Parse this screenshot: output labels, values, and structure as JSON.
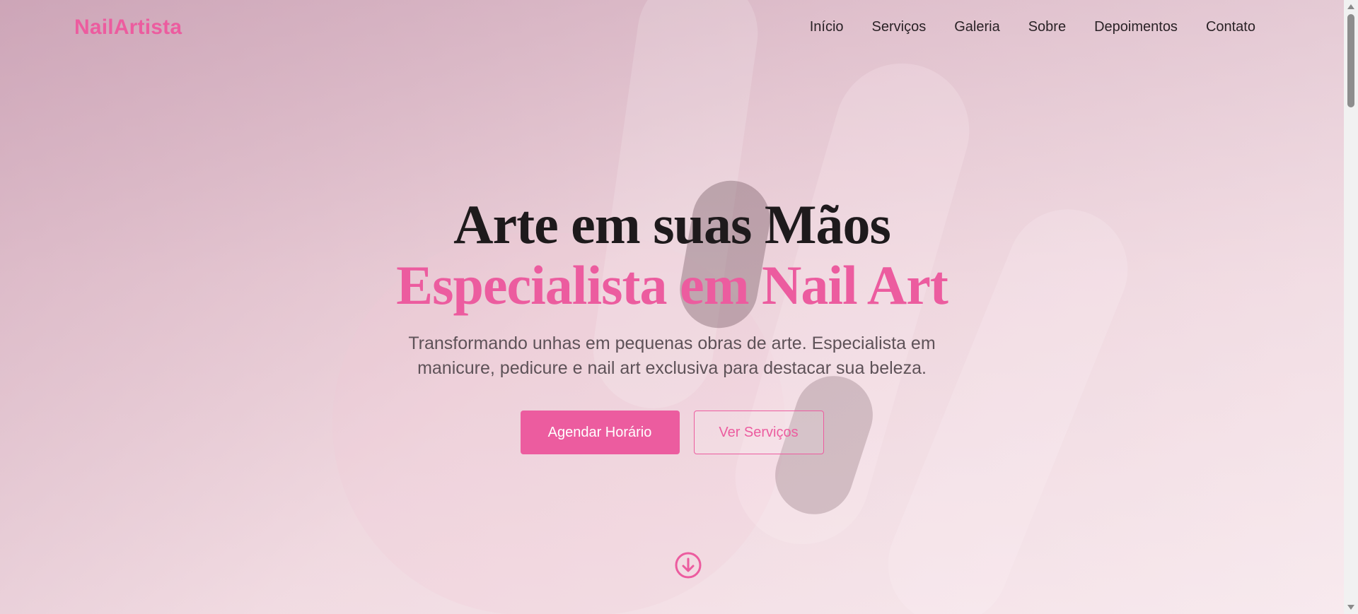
{
  "brand": {
    "name": "NailArtista",
    "accent": "#ec5c9f"
  },
  "nav": {
    "items": [
      {
        "label": "Início"
      },
      {
        "label": "Serviços"
      },
      {
        "label": "Galeria"
      },
      {
        "label": "Sobre"
      },
      {
        "label": "Depoimentos"
      },
      {
        "label": "Contato"
      }
    ]
  },
  "hero": {
    "title_line1": "Arte em suas Mãos",
    "title_line2": "Especialista em Nail Art",
    "subtitle": "Transformando unhas em pequenas obras de arte. Especialista em manicure, pedicure e nail art exclusiva para destacar sua beleza.",
    "primary_button": "Agendar Horário",
    "secondary_button": "Ver Serviços",
    "scroll_icon": "arrow-down-circle-icon"
  }
}
